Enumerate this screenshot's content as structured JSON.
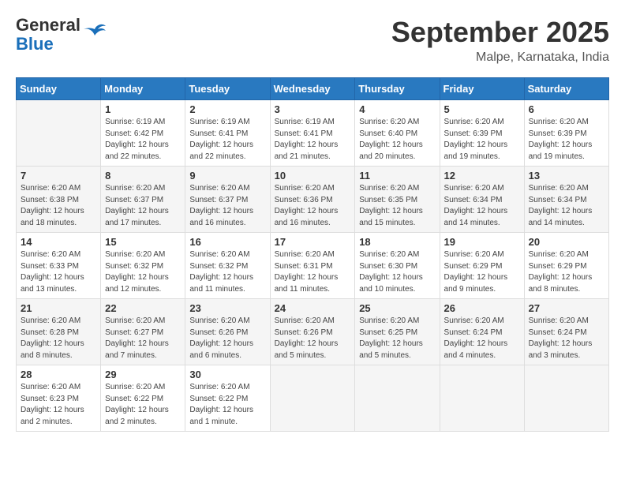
{
  "header": {
    "logo_general": "General",
    "logo_blue": "Blue",
    "month": "September 2025",
    "location": "Malpe, Karnataka, India"
  },
  "weekdays": [
    "Sunday",
    "Monday",
    "Tuesday",
    "Wednesday",
    "Thursday",
    "Friday",
    "Saturday"
  ],
  "weeks": [
    [
      {
        "day": "",
        "info": ""
      },
      {
        "day": "1",
        "info": "Sunrise: 6:19 AM\nSunset: 6:42 PM\nDaylight: 12 hours\nand 22 minutes."
      },
      {
        "day": "2",
        "info": "Sunrise: 6:19 AM\nSunset: 6:41 PM\nDaylight: 12 hours\nand 22 minutes."
      },
      {
        "day": "3",
        "info": "Sunrise: 6:19 AM\nSunset: 6:41 PM\nDaylight: 12 hours\nand 21 minutes."
      },
      {
        "day": "4",
        "info": "Sunrise: 6:20 AM\nSunset: 6:40 PM\nDaylight: 12 hours\nand 20 minutes."
      },
      {
        "day": "5",
        "info": "Sunrise: 6:20 AM\nSunset: 6:39 PM\nDaylight: 12 hours\nand 19 minutes."
      },
      {
        "day": "6",
        "info": "Sunrise: 6:20 AM\nSunset: 6:39 PM\nDaylight: 12 hours\nand 19 minutes."
      }
    ],
    [
      {
        "day": "7",
        "info": "Sunrise: 6:20 AM\nSunset: 6:38 PM\nDaylight: 12 hours\nand 18 minutes."
      },
      {
        "day": "8",
        "info": "Sunrise: 6:20 AM\nSunset: 6:37 PM\nDaylight: 12 hours\nand 17 minutes."
      },
      {
        "day": "9",
        "info": "Sunrise: 6:20 AM\nSunset: 6:37 PM\nDaylight: 12 hours\nand 16 minutes."
      },
      {
        "day": "10",
        "info": "Sunrise: 6:20 AM\nSunset: 6:36 PM\nDaylight: 12 hours\nand 16 minutes."
      },
      {
        "day": "11",
        "info": "Sunrise: 6:20 AM\nSunset: 6:35 PM\nDaylight: 12 hours\nand 15 minutes."
      },
      {
        "day": "12",
        "info": "Sunrise: 6:20 AM\nSunset: 6:34 PM\nDaylight: 12 hours\nand 14 minutes."
      },
      {
        "day": "13",
        "info": "Sunrise: 6:20 AM\nSunset: 6:34 PM\nDaylight: 12 hours\nand 14 minutes."
      }
    ],
    [
      {
        "day": "14",
        "info": "Sunrise: 6:20 AM\nSunset: 6:33 PM\nDaylight: 12 hours\nand 13 minutes."
      },
      {
        "day": "15",
        "info": "Sunrise: 6:20 AM\nSunset: 6:32 PM\nDaylight: 12 hours\nand 12 minutes."
      },
      {
        "day": "16",
        "info": "Sunrise: 6:20 AM\nSunset: 6:32 PM\nDaylight: 12 hours\nand 11 minutes."
      },
      {
        "day": "17",
        "info": "Sunrise: 6:20 AM\nSunset: 6:31 PM\nDaylight: 12 hours\nand 11 minutes."
      },
      {
        "day": "18",
        "info": "Sunrise: 6:20 AM\nSunset: 6:30 PM\nDaylight: 12 hours\nand 10 minutes."
      },
      {
        "day": "19",
        "info": "Sunrise: 6:20 AM\nSunset: 6:29 PM\nDaylight: 12 hours\nand 9 minutes."
      },
      {
        "day": "20",
        "info": "Sunrise: 6:20 AM\nSunset: 6:29 PM\nDaylight: 12 hours\nand 8 minutes."
      }
    ],
    [
      {
        "day": "21",
        "info": "Sunrise: 6:20 AM\nSunset: 6:28 PM\nDaylight: 12 hours\nand 8 minutes."
      },
      {
        "day": "22",
        "info": "Sunrise: 6:20 AM\nSunset: 6:27 PM\nDaylight: 12 hours\nand 7 minutes."
      },
      {
        "day": "23",
        "info": "Sunrise: 6:20 AM\nSunset: 6:26 PM\nDaylight: 12 hours\nand 6 minutes."
      },
      {
        "day": "24",
        "info": "Sunrise: 6:20 AM\nSunset: 6:26 PM\nDaylight: 12 hours\nand 5 minutes."
      },
      {
        "day": "25",
        "info": "Sunrise: 6:20 AM\nSunset: 6:25 PM\nDaylight: 12 hours\nand 5 minutes."
      },
      {
        "day": "26",
        "info": "Sunrise: 6:20 AM\nSunset: 6:24 PM\nDaylight: 12 hours\nand 4 minutes."
      },
      {
        "day": "27",
        "info": "Sunrise: 6:20 AM\nSunset: 6:24 PM\nDaylight: 12 hours\nand 3 minutes."
      }
    ],
    [
      {
        "day": "28",
        "info": "Sunrise: 6:20 AM\nSunset: 6:23 PM\nDaylight: 12 hours\nand 2 minutes."
      },
      {
        "day": "29",
        "info": "Sunrise: 6:20 AM\nSunset: 6:22 PM\nDaylight: 12 hours\nand 2 minutes."
      },
      {
        "day": "30",
        "info": "Sunrise: 6:20 AM\nSunset: 6:22 PM\nDaylight: 12 hours\nand 1 minute."
      },
      {
        "day": "",
        "info": ""
      },
      {
        "day": "",
        "info": ""
      },
      {
        "day": "",
        "info": ""
      },
      {
        "day": "",
        "info": ""
      }
    ]
  ]
}
